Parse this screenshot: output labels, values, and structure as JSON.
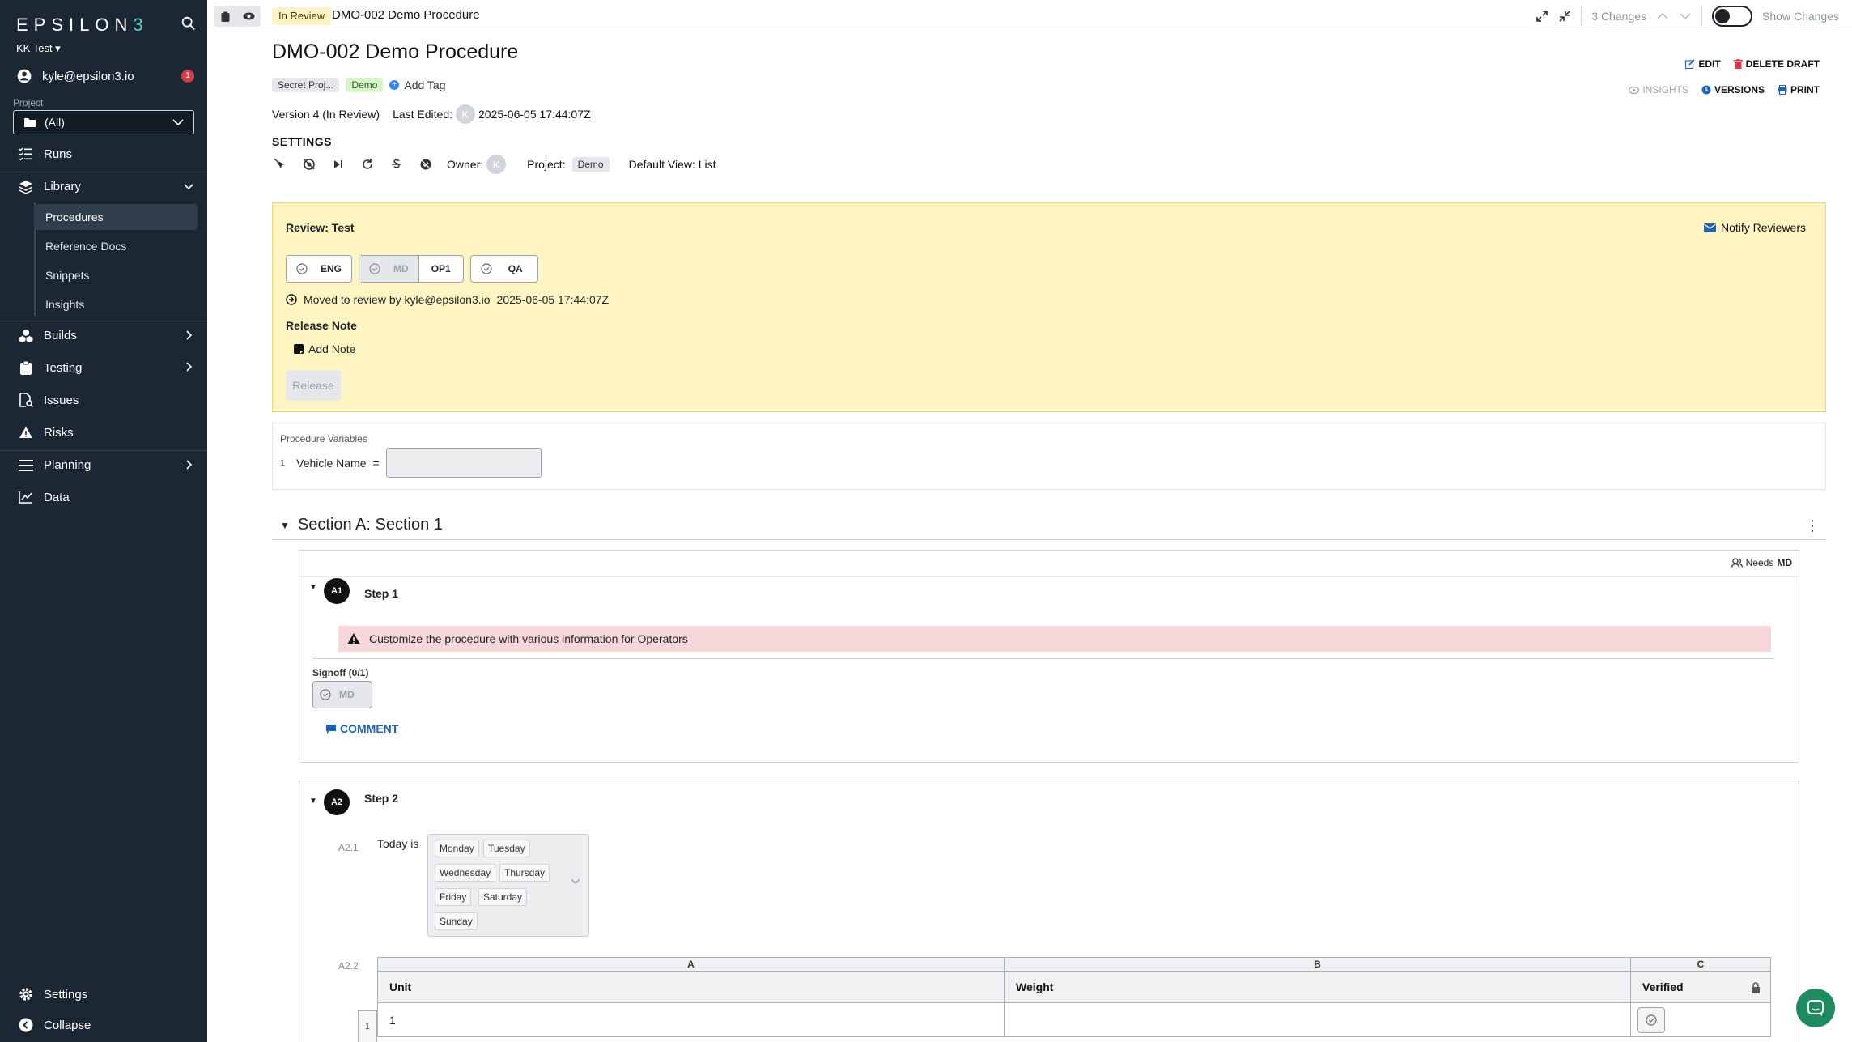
{
  "sidebar": {
    "logo": {
      "prefix": "EPSILON",
      "suffix": "3"
    },
    "org": "KK Test ▾",
    "user": {
      "email": "kyle@epsilon3.io",
      "badge": "1"
    },
    "project_label": "Project",
    "project_value": "(All)",
    "nav": {
      "runs": "Runs",
      "library": "Library",
      "builds": "Builds",
      "testing": "Testing",
      "issues": "Issues",
      "risks": "Risks",
      "planning": "Planning",
      "data": "Data",
      "settings": "Settings",
      "collapse": "Collapse"
    },
    "library_items": [
      "Procedures",
      "Reference Docs",
      "Snippets",
      "Insights"
    ]
  },
  "topbar": {
    "status": "In Review",
    "title": "DMO-002 Demo Procedure",
    "changes": "3 Changes",
    "show_changes": "Show Changes"
  },
  "header": {
    "title": "DMO-002 Demo Procedure",
    "tags": [
      "Secret Proj...",
      "Demo"
    ],
    "add_tag": "Add Tag",
    "version": "Version 4 (In Review)",
    "last_edited_label": "Last Edited:",
    "last_edited_avatar": "K",
    "last_edited": "2025-06-05 17:44:07Z",
    "settings_label": "SETTINGS",
    "owner_label": "Owner:",
    "owner_avatar": "K",
    "project_label": "Project:",
    "project_tag": "Demo",
    "default_view": "Default View: List",
    "actions": {
      "edit": "EDIT",
      "delete": "DELETE DRAFT",
      "insights": "INSIGHTS",
      "versions": "VERSIONS",
      "print": "PRINT"
    }
  },
  "review": {
    "title": "Review: Test",
    "notify": "Notify Reviewers",
    "reviewers": {
      "eng": "ENG",
      "md": "MD",
      "op1": "OP1",
      "qa": "QA"
    },
    "moved_text": "Moved to review by kyle@epsilon3.io",
    "moved_time": "2025-06-05 17:44:07Z",
    "release_note_label": "Release Note",
    "add_note": "Add Note",
    "release_button": "Release"
  },
  "variables": {
    "title": "Procedure Variables",
    "items": [
      {
        "num": "1",
        "name": "Vehicle Name",
        "eq": "="
      }
    ]
  },
  "section": {
    "title": "Section A: Section 1",
    "needs_label": "Needs",
    "needs_role": "MD",
    "step1": {
      "badge": "A1",
      "title": "Step 1",
      "alert": "Customize the procedure with various information for Operators",
      "signoff_label": "Signoff (0/1)",
      "signoff_role": "MD",
      "comment": "COMMENT"
    },
    "step2": {
      "badge": "A2",
      "title": "Step 2",
      "sub1_num": "A2.1",
      "sub1_label": "Today is",
      "days": [
        "Monday",
        "Tuesday",
        "Wednesday",
        "Thursday",
        "Friday",
        "Saturday",
        "Sunday"
      ],
      "sub2_num": "A2.2",
      "table": {
        "letters": [
          "A",
          "B",
          "C"
        ],
        "headers": [
          "Unit",
          "Weight",
          "Verified"
        ],
        "rows": [
          {
            "num": "1",
            "unit": "1",
            "weight": ""
          }
        ]
      }
    }
  },
  "colors": {
    "sidebar_bg": "#1b2733",
    "review_bg": "#fef5c2",
    "alert_bg": "#f8d7da",
    "accent_blue": "#1d63b8"
  }
}
